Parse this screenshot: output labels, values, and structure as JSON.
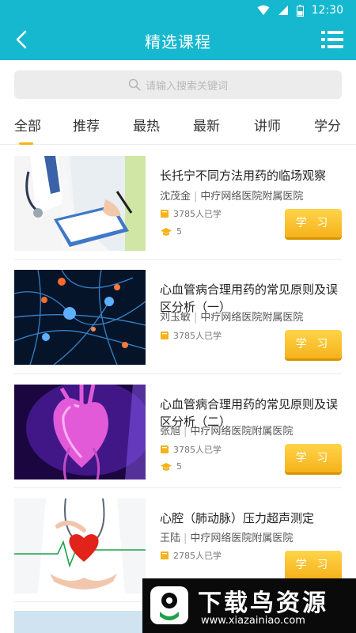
{
  "status_bar": {
    "time": "12:30"
  },
  "header": {
    "title": "精选课程"
  },
  "search": {
    "placeholder": "请输入搜索关键词"
  },
  "tabs": [
    {
      "label": "全部",
      "active": true
    },
    {
      "label": "推荐"
    },
    {
      "label": "最热"
    },
    {
      "label": "最新"
    },
    {
      "label": "讲师"
    },
    {
      "label": "学分"
    }
  ],
  "courses": [
    {
      "title": "长托宁不同方法用药的临场观察",
      "teacher": "沈茂金",
      "org": "中疗网络医院附属医院",
      "learners": "3785人已学",
      "credits": "5",
      "button": "学 习"
    },
    {
      "title": "心血管病合理用药的常见原则及误区分析（一）",
      "teacher": "刘玉敏",
      "org": "中疗网络医院附属医院",
      "learners": "3785人已学",
      "button": "学 习"
    },
    {
      "title": "心血管病合理用药的常见原则及误区分析（二）",
      "teacher": "张旭",
      "org": "中疗网络医院附属医院",
      "learners": "3785人已学",
      "credits": "5",
      "button": "学 习"
    },
    {
      "title": "心腔（肺动脉）压力超声测定",
      "teacher": "王陆",
      "org": "中疗网络医院附属医院",
      "learners": "2785人已学",
      "button": "学 习"
    }
  ],
  "watermark": {
    "main": "下载鸟资源",
    "sub": "www.xiazainiao.com"
  },
  "colors": {
    "primary": "#15b8cf",
    "accent": "#f5b21b",
    "button_shadow": "#d89400"
  },
  "icons": [
    "wifi-icon",
    "signal-icon",
    "battery-icon",
    "back-arrow-icon",
    "menu-list-icon",
    "search-icon",
    "book-icon",
    "graduation-cap-icon"
  ]
}
